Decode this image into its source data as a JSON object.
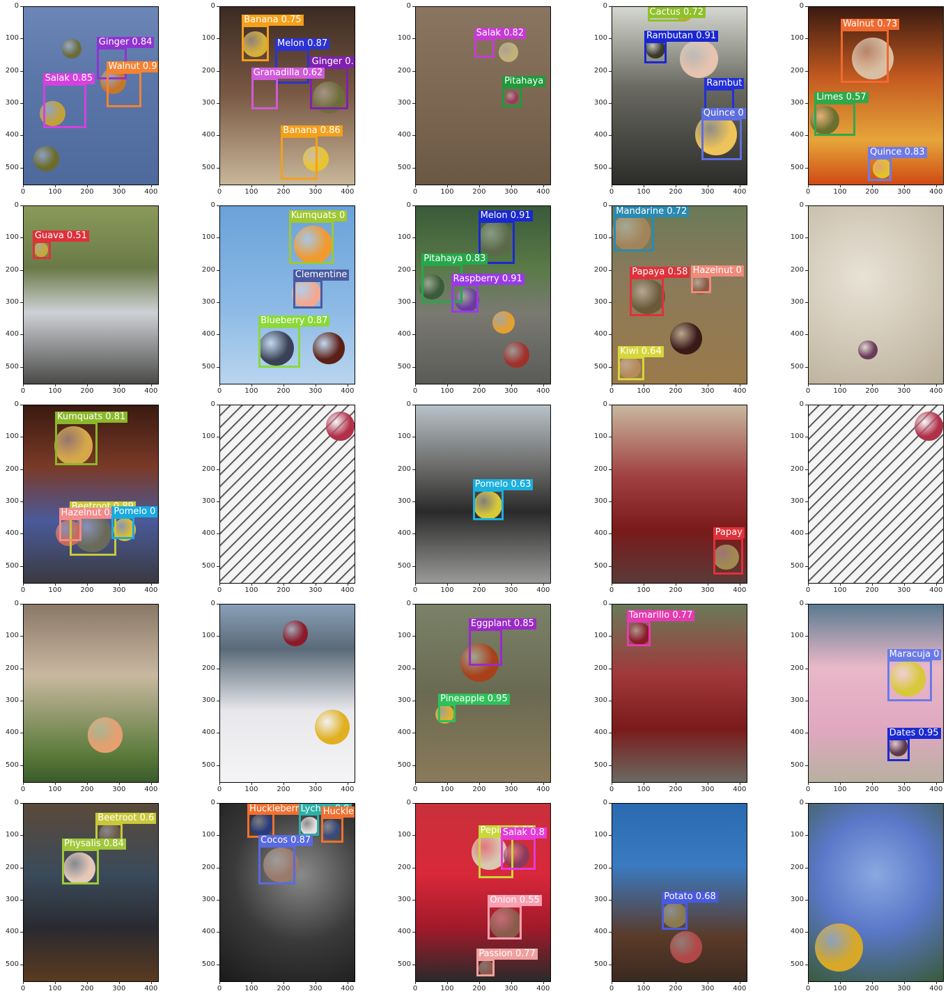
{
  "axes": {
    "yticks": [
      "0",
      "100",
      "200",
      "300",
      "400",
      "500"
    ],
    "xticks": [
      "0",
      "100",
      "200",
      "300",
      "400"
    ],
    "data_width": 420,
    "data_height": 550
  },
  "panels": [
    {
      "bg": "linear-gradient(180deg,#6d86b8 0%,#5b76a8 40%,#4e6a9c 100%)",
      "fruits": [
        {
          "x": 90,
          "y": 330,
          "r": 40,
          "c": "#c2a13a"
        },
        {
          "x": 150,
          "y": 130,
          "r": 30,
          "c": "#6b6b3a"
        },
        {
          "x": 280,
          "y": 230,
          "r": 40,
          "c": "#c6762a"
        },
        {
          "x": 70,
          "y": 470,
          "r": 40,
          "c": "#6b6c2a"
        }
      ],
      "dets": [
        {
          "label": "Ginger 0.84",
          "color": "#8f33d1",
          "box": [
            228,
            125,
            323,
            225
          ]
        },
        {
          "label": "Walnut 0.9",
          "color": "#f58232",
          "box": [
            258,
            200,
            368,
            310
          ]
        },
        {
          "label": "Salak 0.85",
          "color": "#d640e0",
          "box": [
            60,
            238,
            195,
            375
          ]
        }
      ]
    },
    {
      "bg": "linear-gradient(180deg,#3b2a22 0%,#7a5a45 50%,#c9b79a 100%)",
      "fruits": [
        {
          "x": 110,
          "y": 115,
          "r": 40,
          "c": "#d6b03a"
        },
        {
          "x": 340,
          "y": 280,
          "r": 50,
          "c": "#6d6d3a"
        },
        {
          "x": 300,
          "y": 470,
          "r": 40,
          "c": "#e8c530"
        }
      ],
      "dets": [
        {
          "label": "Banana 0.75",
          "color": "#f4a01a",
          "box": [
            68,
            55,
            153,
            168
          ]
        },
        {
          "label": "Melon 0.87",
          "color": "#2b32d6",
          "box": [
            172,
            130,
            278,
            238
          ]
        },
        {
          "label": "Ginger 0.",
          "color": "#8020b0",
          "box": [
            280,
            185,
            400,
            318
          ]
        },
        {
          "label": "Granadilla 0.62",
          "color": "#d05ad8",
          "box": [
            97,
            220,
            180,
            318
          ]
        },
        {
          "label": "Banana 0.86",
          "color": "#f4a01a",
          "box": [
            190,
            398,
            305,
            535
          ]
        }
      ]
    },
    {
      "bg": "linear-gradient(180deg,#8a7660 0%,#7a6550 60%,#6a5844 100%)",
      "fruits": [
        {
          "x": 290,
          "y": 140,
          "r": 30,
          "c": "#c1b27a"
        },
        {
          "x": 300,
          "y": 280,
          "r": 20,
          "c": "#a0365f"
        }
      ],
      "dets": [
        {
          "label": "Salak 0.82",
          "color": "#c63bd4",
          "box": [
            182,
            98,
            245,
            158
          ]
        },
        {
          "label": "Pitahaya",
          "color": "#1f9a3a",
          "box": [
            270,
            245,
            330,
            310
          ]
        }
      ]
    },
    {
      "bg": "linear-gradient(180deg,#d5d8d0 0%,#6a6a62 45%,#2c2c2a 100%)",
      "fruits": [
        {
          "x": 225,
          "y": 20,
          "r": 25,
          "c": "#d2a13a"
        },
        {
          "x": 135,
          "y": 130,
          "r": 30,
          "c": "#3a3a2a"
        },
        {
          "x": 270,
          "y": 160,
          "r": 60,
          "c": "#e7c4b0"
        },
        {
          "x": 325,
          "y": 395,
          "r": 65,
          "c": "#eec45a"
        }
      ],
      "dets": [
        {
          "label": "Cactus 0.72",
          "color": "#8fc12a",
          "box": [
            110,
            0,
            230,
            45
          ]
        },
        {
          "label": "Rambutan 0.91",
          "color": "#1a27d1",
          "box": [
            100,
            105,
            170,
            175
          ]
        },
        {
          "label": "Rambut",
          "color": "#2330d6",
          "box": [
            288,
            252,
            380,
            330
          ]
        },
        {
          "label": "Quince 0",
          "color": "#5e6ee0",
          "box": [
            278,
            345,
            405,
            475
          ]
        }
      ]
    },
    {
      "bg": "linear-gradient(180deg,#3a1a10 0%,#c45a20 40%,#e6a53a 75%,#cf4a14 100%)",
      "fruits": [
        {
          "x": 200,
          "y": 160,
          "r": 65,
          "c": "#d8bfa4"
        },
        {
          "x": 50,
          "y": 350,
          "r": 45,
          "c": "#6b7030"
        },
        {
          "x": 230,
          "y": 500,
          "r": 30,
          "c": "#e0c22a"
        }
      ],
      "dets": [
        {
          "label": "Walnut 0.73",
          "color": "#f06a30",
          "box": [
            100,
            70,
            250,
            235
          ]
        },
        {
          "label": "Limes 0.57",
          "color": "#2fa84a",
          "box": [
            18,
            295,
            145,
            400
          ]
        },
        {
          "label": "Quince 0.83",
          "color": "#6e7ae8",
          "box": [
            185,
            465,
            260,
            540
          ]
        }
      ]
    },
    {
      "bg": "linear-gradient(180deg,#8a9a5a 0%,#6a7a48 35%,#cfd1d6 60%,#4a4a48 100%)",
      "fruits": [
        {
          "x": 55,
          "y": 135,
          "r": 22,
          "c": "#c9a53a"
        }
      ],
      "dets": [
        {
          "label": "Guava 0.51",
          "color": "#e0303a",
          "box": [
            28,
            108,
            85,
            165
          ]
        }
      ]
    },
    {
      "bg": "linear-gradient(180deg,#6aa2d9 0%,#8ebbe6 60%,#b9d5ef 100%)",
      "fruits": [
        {
          "x": 290,
          "y": 120,
          "r": 60,
          "c": "#f09a30"
        },
        {
          "x": 270,
          "y": 270,
          "r": 45,
          "c": "#f2a890"
        },
        {
          "x": 175,
          "y": 440,
          "r": 55,
          "c": "#3a4055"
        },
        {
          "x": 340,
          "y": 440,
          "r": 50,
          "c": "#5a1f15"
        }
      ],
      "dets": [
        {
          "label": "Kumquats 0",
          "color": "#a0c830",
          "box": [
            215,
            45,
            355,
            178
          ]
        },
        {
          "label": "Clementine",
          "color": "#4a5aa0",
          "box": [
            228,
            228,
            320,
            318
          ]
        },
        {
          "label": "Blueberry 0.87",
          "color": "#8bd83a",
          "box": [
            120,
            370,
            250,
            500
          ]
        }
      ]
    },
    {
      "bg": "linear-gradient(180deg,#3a5a3a 0%,#5a7a48 35%,#7a7a72 60%,#5a5a58 100%)",
      "fruits": [
        {
          "x": 250,
          "y": 100,
          "r": 55,
          "c": "#5a6a4a"
        },
        {
          "x": 50,
          "y": 250,
          "r": 40,
          "c": "#3a5a3a"
        },
        {
          "x": 160,
          "y": 290,
          "r": 38,
          "c": "#6a3aa0"
        },
        {
          "x": 275,
          "y": 360,
          "r": 35,
          "c": "#e6a030"
        },
        {
          "x": 315,
          "y": 460,
          "r": 40,
          "c": "#a0302a"
        }
      ],
      "dets": [
        {
          "label": "Melon 0.91",
          "color": "#1a28d0",
          "box": [
            195,
            45,
            310,
            180
          ]
        },
        {
          "label": "Pitahaya 0.83",
          "color": "#25a84a",
          "box": [
            18,
            178,
            145,
            300
          ]
        },
        {
          "label": "Raspberry 0.91",
          "color": "#9a3ae6",
          "box": [
            110,
            242,
            195,
            330
          ]
        }
      ]
    },
    {
      "bg": "linear-gradient(180deg,#6a7a58 0%,#8a7a5a 40%,#9a7a4a 100%)",
      "fruits": [
        {
          "x": 60,
          "y": 80,
          "r": 60,
          "c": "#a3845a"
        },
        {
          "x": 110,
          "y": 280,
          "r": 55,
          "c": "#6a5a3a"
        },
        {
          "x": 275,
          "y": 245,
          "r": 30,
          "c": "#8a5a48"
        },
        {
          "x": 230,
          "y": 410,
          "r": 50,
          "c": "#3a1a18"
        },
        {
          "x": 55,
          "y": 500,
          "r": 35,
          "c": "#b68a5a"
        }
      ],
      "dets": [
        {
          "label": "Mandarine 0.72",
          "color": "#2a8ab0",
          "box": [
            5,
            30,
            130,
            140
          ]
        },
        {
          "label": "Hazelnut 0",
          "color": "#f08a7a",
          "box": [
            245,
            215,
            310,
            270
          ]
        },
        {
          "label": "Papaya 0.58",
          "color": "#e0303a",
          "box": [
            55,
            220,
            160,
            340
          ]
        },
        {
          "label": "Kiwi 0.64",
          "color": "#d6d63a",
          "box": [
            18,
            465,
            100,
            540
          ]
        }
      ]
    },
    {
      "bg": "radial-gradient(circle at 40% 40%,#e8e2d6 0%,#d2c9b8 50%,#b8ad98 100%)",
      "fruits": [
        {
          "x": 185,
          "y": 445,
          "r": 30,
          "c": "#6a3a5a"
        }
      ],
      "dets": []
    },
    {
      "bg": "linear-gradient(180deg,#3a1a10 0%,#7a3a28 35%,#4a5a9a 65%,#3a3a40 100%)",
      "fruits": [
        {
          "x": 155,
          "y": 125,
          "r": 60,
          "c": "#d6a84a"
        },
        {
          "x": 215,
          "y": 395,
          "r": 60,
          "c": "#6a6a5a"
        },
        {
          "x": 315,
          "y": 385,
          "r": 35,
          "c": "#e0c02a"
        },
        {
          "x": 140,
          "y": 395,
          "r": 40,
          "c": "#c86a5a"
        }
      ],
      "dets": [
        {
          "label": "Kumquats 0.81",
          "color": "#8ab82a",
          "box": [
            98,
            52,
            230,
            185
          ]
        },
        {
          "label": "Beetroot 0.89",
          "color": "#c8c83a",
          "box": [
            143,
            330,
            290,
            465
          ]
        },
        {
          "label": "Hazelnut 0.58",
          "color": "#f48a8a",
          "box": [
            110,
            350,
            180,
            420
          ]
        },
        {
          "label": "Pomelo 0",
          "color": "#1aaae0",
          "box": [
            275,
            345,
            345,
            415
          ]
        }
      ]
    },
    {
      "bg": "repeating-linear-gradient(135deg,#f4f4f4 0px,#f4f4f4 9px,#222 10px,#f4f4f4 12px)",
      "fruits": [
        {
          "x": 375,
          "y": 65,
          "r": 45,
          "c": "#b0304a"
        }
      ],
      "dets": []
    },
    {
      "bg": "linear-gradient(180deg,#b8c2c8 0%,#6a6a68 35%,#2a2a2a 60%,#9a9a98 100%)",
      "fruits": [
        {
          "x": 225,
          "y": 310,
          "r": 45,
          "c": "#d8c83a"
        }
      ],
      "dets": [
        {
          "label": "Pomelo 0.63",
          "color": "#1ab0e0",
          "box": [
            178,
            262,
            275,
            355
          ]
        }
      ]
    },
    {
      "bg": "linear-gradient(180deg,#c8b8a0 0%,#a04040 40%,#7a1a1a 70%,#5a3a38 100%)",
      "fruits": [
        {
          "x": 355,
          "y": 470,
          "r": 40,
          "c": "#a08a50"
        }
      ],
      "dets": [
        {
          "label": "Papay",
          "color": "#e0303a",
          "box": [
            315,
            410,
            410,
            525
          ]
        }
      ]
    },
    {
      "bg": "repeating-linear-gradient(135deg,#f4f4f4 0px,#f4f4f4 9px,#222 10px,#f4f4f4 12px)",
      "fruits": [
        {
          "x": 375,
          "y": 65,
          "r": 45,
          "c": "#b0304a"
        }
      ],
      "dets": []
    },
    {
      "bg": "linear-gradient(180deg,#8a7868 0%,#c9b8a0 40%,#5a7a3a 85%,#3a5a2a 100%)",
      "fruits": [
        {
          "x": 255,
          "y": 405,
          "r": 55,
          "c": "#e6a070"
        }
      ],
      "dets": []
    },
    {
      "bg": "linear-gradient(180deg,#8aa0b8 0%,#5a6a78 25%,#e8e8ec 60%,#f4f4f6 100%)",
      "fruits": [
        {
          "x": 235,
          "y": 90,
          "r": 40,
          "c": "#8a1a2a"
        },
        {
          "x": 350,
          "y": 380,
          "r": 55,
          "c": "#e0b020"
        }
      ],
      "dets": []
    },
    {
      "bg": "linear-gradient(180deg,#7a8268 0%,#6a6a52 50%,#8a7a5a 100%)",
      "fruits": [
        {
          "x": 200,
          "y": 180,
          "r": 60,
          "c": "#a8401a"
        },
        {
          "x": 90,
          "y": 340,
          "r": 30,
          "c": "#e0b030"
        }
      ],
      "dets": [
        {
          "label": "Eggplant 0.85",
          "color": "#9a2ac8",
          "box": [
            165,
            75,
            270,
            190
          ]
        },
        {
          "label": "Pineapple 0.95",
          "color": "#2fc05a",
          "box": [
            70,
            308,
            125,
            365
          ]
        }
      ]
    },
    {
      "bg": "linear-gradient(180deg,#6a7a5a 0%,#a0383a 40%,#7a1a1a 70%,#6a6a62 100%)",
      "fruits": [
        {
          "x": 85,
          "y": 90,
          "r": 35,
          "c": "#8a1a2a"
        }
      ],
      "dets": [
        {
          "label": "Tamarillo 0.77",
          "color": "#e63ab0",
          "box": [
            45,
            50,
            120,
            130
          ]
        }
      ]
    },
    {
      "bg": "linear-gradient(180deg,#5a7a90 0%,#e8b8c8 35%,#e0a8c0 70%,#b8b0a0 100%)",
      "fruits": [
        {
          "x": 310,
          "y": 230,
          "r": 55,
          "c": "#d8c83a"
        },
        {
          "x": 280,
          "y": 440,
          "r": 30,
          "c": "#5a3a4a"
        }
      ],
      "dets": [
        {
          "label": "Maracuja 0",
          "color": "#6a7ae8",
          "box": [
            245,
            170,
            385,
            300
          ]
        },
        {
          "label": "Dates 0.95",
          "color": "#1a2ad0",
          "box": [
            245,
            415,
            315,
            485
          ]
        }
      ]
    },
    {
      "bg": "linear-gradient(180deg,#5a4a3a 0%,#3a4a5a 40%,#2a2a30 70%,#5a3a20 100%)",
      "fruits": [
        {
          "x": 270,
          "y": 95,
          "r": 35,
          "c": "#6a5a4a"
        },
        {
          "x": 175,
          "y": 200,
          "r": 50,
          "c": "#e6c8b8"
        }
      ],
      "dets": [
        {
          "label": "Beetroot 0.6",
          "color": "#c8c83a",
          "box": [
            225,
            60,
            310,
            140
          ]
        },
        {
          "label": "Physalis 0.84",
          "color": "#a0c83a",
          "box": [
            120,
            140,
            235,
            250
          ]
        }
      ]
    },
    {
      "bg": "radial-gradient(circle at 60% 40%,#8a8a8a 0%,#3a3a3a 50%,#1a1a1a 100%)",
      "fruits": [
        {
          "x": 130,
          "y": 65,
          "r": 35,
          "c": "#2a3a7a"
        },
        {
          "x": 280,
          "y": 70,
          "r": 30,
          "c": "#e8e0e0"
        },
        {
          "x": 345,
          "y": 80,
          "r": 30,
          "c": "#3a4a7a"
        },
        {
          "x": 190,
          "y": 190,
          "r": 55,
          "c": "#9a7a6a"
        }
      ],
      "dets": [
        {
          "label": "Huckleberr",
          "color": "#f07030",
          "box": [
            85,
            20,
            170,
            105
          ]
        },
        {
          "label": "Lychee 0.9",
          "color": "#2ab0a8",
          "box": [
            245,
            30,
            310,
            100
          ]
        },
        {
          "label": "Huckle",
          "color": "#f07030",
          "box": [
            315,
            40,
            385,
            120
          ]
        },
        {
          "label": "Cocos 0.87",
          "color": "#5a6ae0",
          "box": [
            120,
            130,
            235,
            250
          ]
        }
      ]
    },
    {
      "bg": "linear-gradient(180deg,#c8303a 0%,#d8283a 40%,#a01a2a 70%,#2a2a2a 100%)",
      "fruits": [
        {
          "x": 230,
          "y": 150,
          "r": 55,
          "c": "#d8c8b0"
        },
        {
          "x": 315,
          "y": 160,
          "r": 40,
          "c": "#8a3a5a"
        },
        {
          "x": 280,
          "y": 370,
          "r": 50,
          "c": "#8a5a4a"
        },
        {
          "x": 220,
          "y": 510,
          "r": 25,
          "c": "#8a5a48"
        }
      ],
      "dets": [
        {
          "label": "Pepino 0.88",
          "color": "#c8d83a",
          "box": [
            195,
            100,
            305,
            230
          ]
        },
        {
          "label": "Salak 0.8",
          "color": "#e63ad8",
          "box": [
            265,
            105,
            375,
            205
          ]
        },
        {
          "label": "Onion 0.55",
          "color": "#f8a0b0",
          "box": [
            225,
            315,
            330,
            420
          ]
        },
        {
          "label": "Passion 0.77",
          "color": "#f0a0a0",
          "box": [
            190,
            480,
            245,
            535
          ]
        }
      ]
    },
    {
      "bg": "linear-gradient(180deg,#2a6ab0 0%,#3a7ac0 35%,#5a3a28 75%,#3a2a20 100%)",
      "fruits": [
        {
          "x": 195,
          "y": 345,
          "r": 40,
          "c": "#8a7a4a"
        },
        {
          "x": 230,
          "y": 445,
          "r": 50,
          "c": "#b04848"
        }
      ],
      "dets": [
        {
          "label": "Potato 0.68",
          "color": "#4a5ae0",
          "box": [
            155,
            305,
            235,
            390
          ]
        }
      ]
    },
    {
      "bg": "radial-gradient(circle at 50% 40%,#8aa8e0 0%,#5a78c8 45%,#3a5a3a 100%)",
      "fruits": [
        {
          "x": 95,
          "y": 445,
          "r": 75,
          "c": "#d8a828"
        }
      ],
      "dets": []
    }
  ]
}
